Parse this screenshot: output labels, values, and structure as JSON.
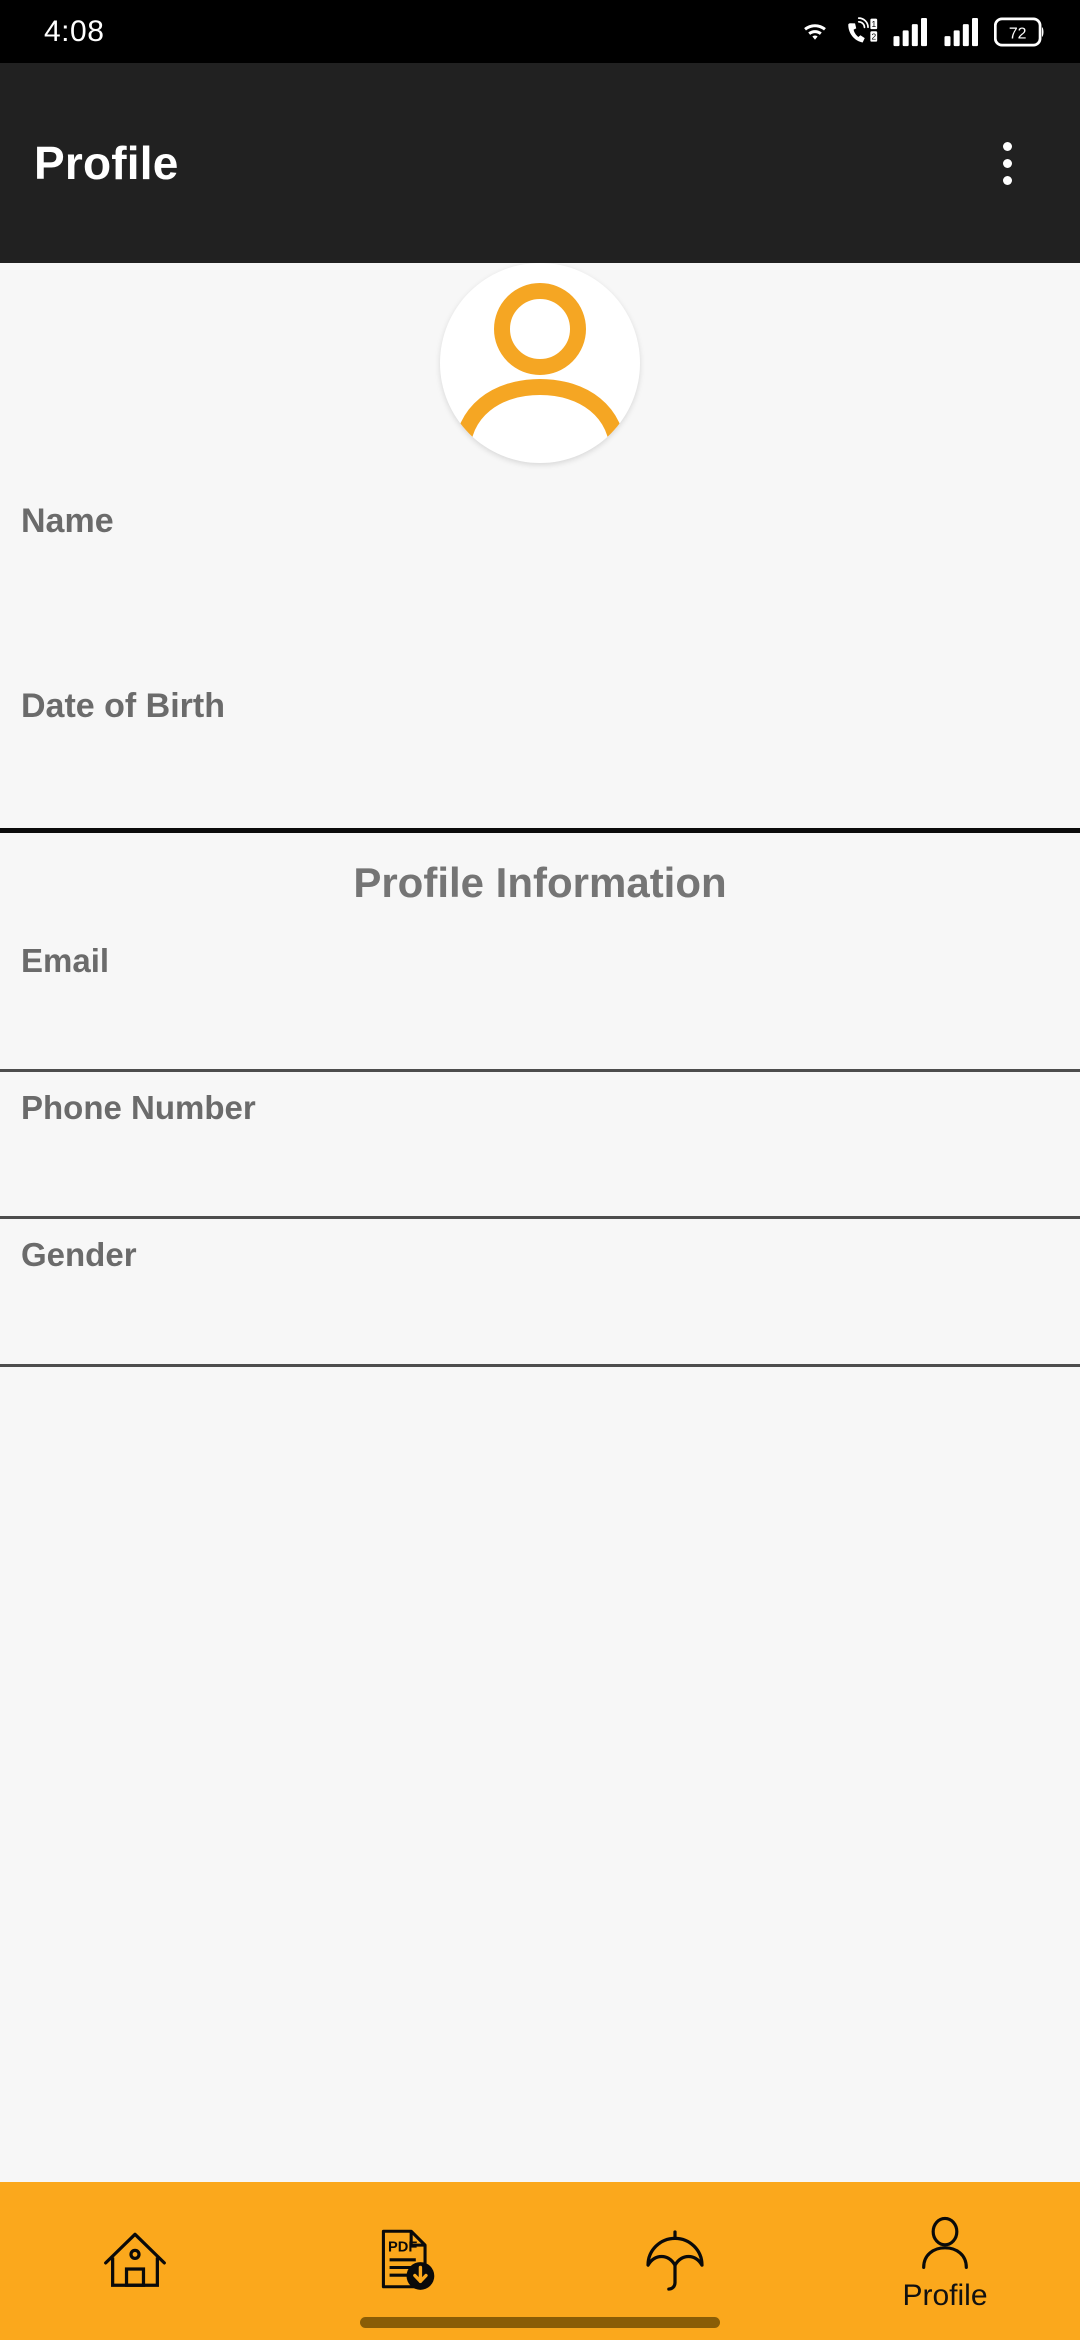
{
  "status_bar": {
    "time": "4:08",
    "battery_level": "72",
    "icons": [
      "wifi-icon",
      "volte-dual-sim-icon",
      "signal-sim1-icon",
      "signal-sim2-icon",
      "battery-icon"
    ]
  },
  "app_bar": {
    "title": "Profile",
    "overflow_menu": "more-options"
  },
  "avatar": {
    "icon": "person-avatar-icon",
    "color": "#F5A623"
  },
  "top_fields": [
    {
      "label": "Name",
      "value": ""
    },
    {
      "label": "Date of Birth",
      "value": ""
    }
  ],
  "section": {
    "title": "Profile Information"
  },
  "info_fields": [
    {
      "label": "Email",
      "value": ""
    },
    {
      "label": "Phone Number",
      "value": ""
    },
    {
      "label": "Gender",
      "value": ""
    }
  ],
  "bottom_nav": {
    "background": "#FBA81C",
    "items": [
      {
        "label": "",
        "icon": "home-icon",
        "selected": false
      },
      {
        "label": "",
        "icon": "pdf-download-icon",
        "selected": false
      },
      {
        "label": "",
        "icon": "umbrella-icon",
        "selected": false
      },
      {
        "label": "Profile",
        "icon": "person-icon",
        "selected": true
      }
    ]
  },
  "colors": {
    "accent": "#FBA81C",
    "app_bar": "#212121",
    "background": "#F7F7F7",
    "label_text": "#6B6B6B",
    "divider": "#4D4D4D"
  }
}
